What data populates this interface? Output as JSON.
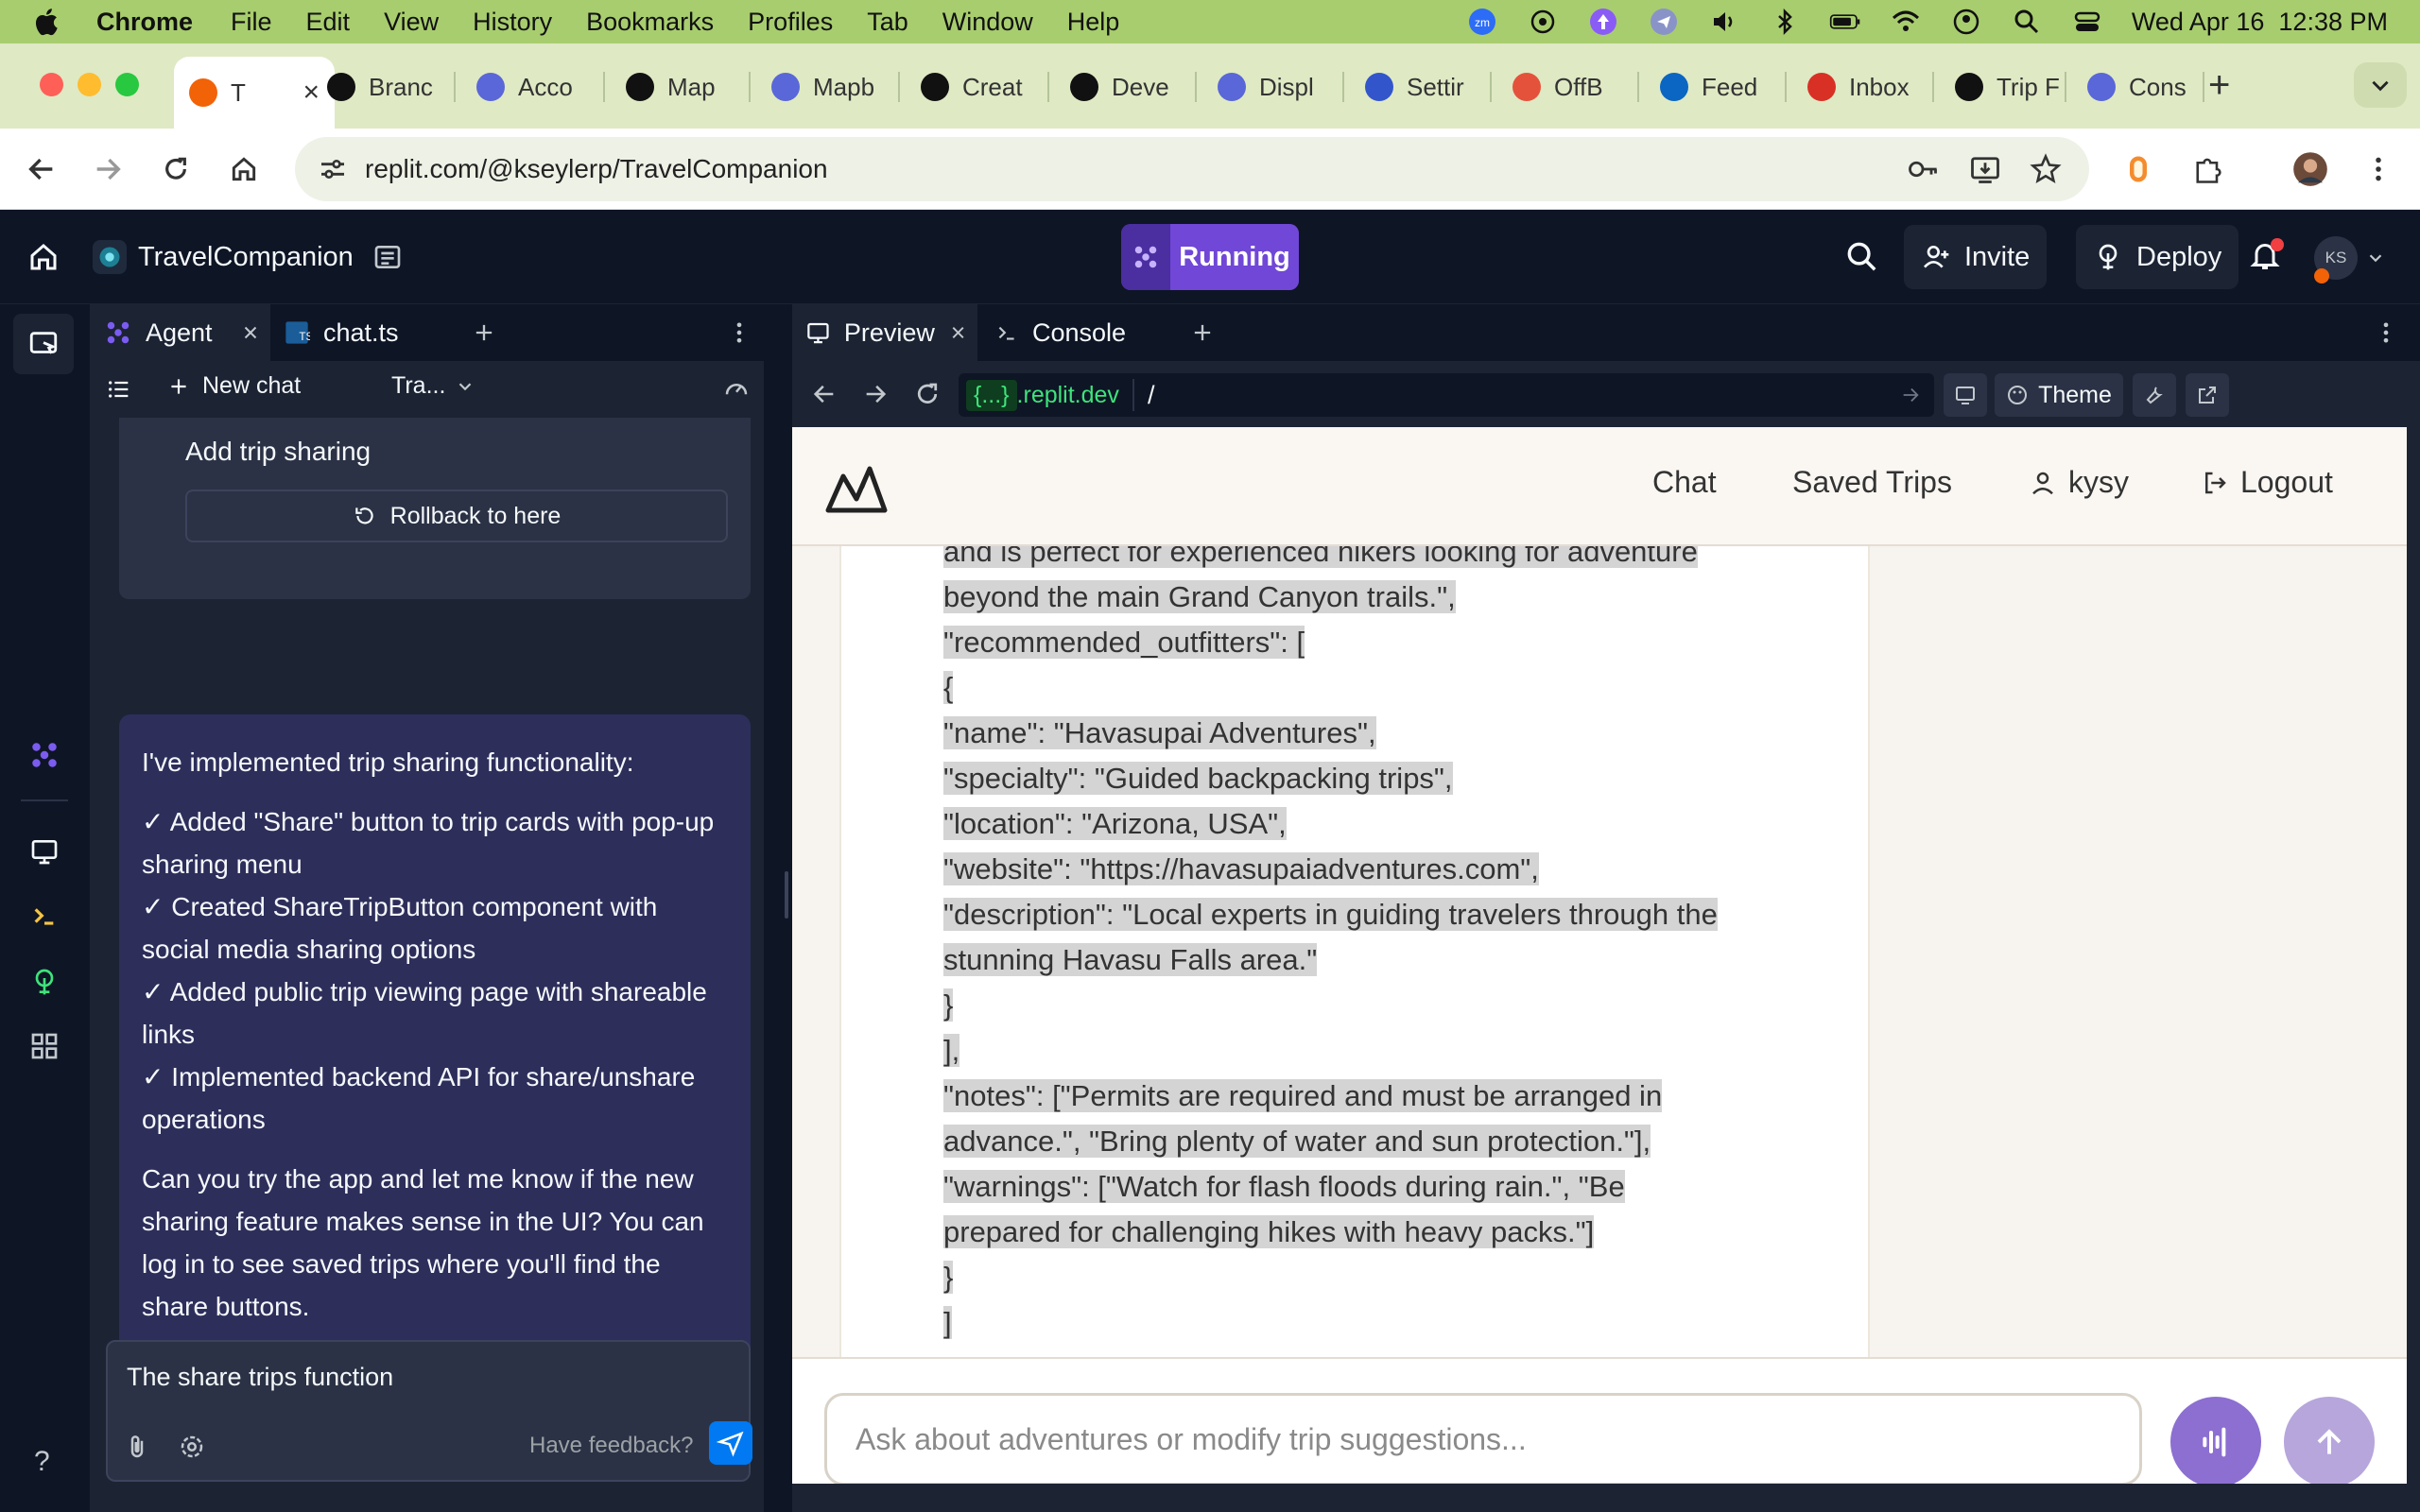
{
  "menubar": {
    "app": "Chrome",
    "items": [
      "File",
      "Edit",
      "View",
      "History",
      "Bookmarks",
      "Profiles",
      "Tab",
      "Window",
      "Help"
    ],
    "clock": "Wed Apr 16  12:38 PM"
  },
  "tabs": [
    {
      "label": "T",
      "icon": "replit-icon",
      "color": "#f26207",
      "active": true
    },
    {
      "label": "Branc",
      "icon": "github-icon",
      "color": "#111111"
    },
    {
      "label": "Acco",
      "icon": "circle-icon",
      "color": "#5a67d8"
    },
    {
      "label": "Map",
      "icon": "circle-icon",
      "color": "#111111"
    },
    {
      "label": "Mapb",
      "icon": "circle-icon",
      "color": "#5a67d8"
    },
    {
      "label": "Creat",
      "icon": "circle-icon",
      "color": "#111111"
    },
    {
      "label": "Deve",
      "icon": "circle-icon",
      "color": "#111111"
    },
    {
      "label": "Displ",
      "icon": "cloud-icon",
      "color": "#5a67d8"
    },
    {
      "label": "Settir",
      "icon": "mail-icon",
      "color": "#3355cc"
    },
    {
      "label": "OffB",
      "icon": "figma-icon",
      "color": "#e5523b"
    },
    {
      "label": "Feed",
      "icon": "linkedin-icon",
      "color": "#0a66c2"
    },
    {
      "label": "Inbox",
      "icon": "gmail-icon",
      "color": "#d93025"
    },
    {
      "label": "Trip F",
      "icon": "openai-icon",
      "color": "#111111"
    },
    {
      "label": "Cons",
      "icon": "circle-icon",
      "color": "#5a67d8"
    }
  ],
  "address": {
    "url": "replit.com/@kseylerp/TravelCompanion"
  },
  "replit": {
    "project": "TravelCompanion",
    "run_label": "Running",
    "invite": "Invite",
    "deploy": "Deploy",
    "avatar": "KS"
  },
  "left_pane": {
    "tabs": [
      "Agent",
      "chat.ts"
    ],
    "new_chat": "New chat",
    "history_label": "Tra...",
    "step_title": "Add trip sharing",
    "rollback": "Rollback to here",
    "message": [
      "I've implemented trip sharing functionality:",
      "✓ Added \"Share\" button to trip cards with pop-up sharing menu",
      "✓ Created ShareTripButton component with social media sharing options",
      "✓ Added public trip viewing page with shareable links",
      "✓ Implemented backend API for share/unshare operations",
      "Can you try the app and let me know if the new sharing feature makes sense in the UI? You can log in to see saved trips where you'll find the share buttons."
    ],
    "input_text": "The share trips function",
    "feedback": "Have feedback?",
    "help": "?"
  },
  "preview": {
    "tabs": [
      "Preview",
      "Console"
    ],
    "host_badge": "{...}",
    "host": ".replit.dev",
    "path": "/",
    "theme": "Theme",
    "nav": [
      "Chat",
      "Saved Trips",
      "kysy",
      "Logout"
    ],
    "json_lines": [
      "and is perfect for experienced hikers looking for adventure",
      "beyond the main Grand Canyon trails.\",",
      "\"recommended_outfitters\": [",
      "{",
      "\"name\": \"Havasupai Adventures\",",
      "\"specialty\": \"Guided backpacking trips\",",
      "\"location\": \"Arizona, USA\",",
      "\"website\": \"https://havasupaiadventures.com\",",
      "\"description\": \"Local experts in guiding travelers through the",
      "stunning Havasu Falls area.\"",
      "}",
      "],",
      "\"notes\": [\"Permits are required and must be arranged in",
      "advance.\", \"Bring plenty of water and sun protection.\"],",
      "\"warnings\": [\"Watch for flash floods during rain.\", \"Be",
      "prepared for challenging hikes with heavy packs.\"]",
      "}",
      "]"
    ],
    "ask_placeholder": "Ask about adventures or modify trip suggestions..."
  }
}
